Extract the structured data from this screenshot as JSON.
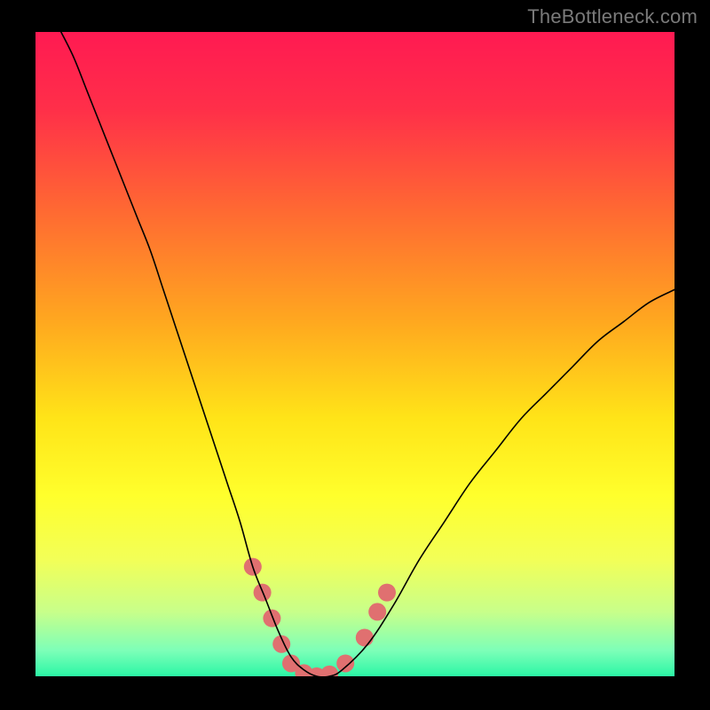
{
  "watermark": {
    "text": "TheBottleneck.com"
  },
  "chart_data": {
    "type": "line",
    "title": "",
    "xlabel": "",
    "ylabel": "",
    "xlim": [
      0,
      100
    ],
    "ylim": [
      0,
      100
    ],
    "grid": false,
    "legend": false,
    "background_gradient": {
      "direction": "vertical",
      "stops": [
        {
          "offset": 0.0,
          "color": "#ff1a52"
        },
        {
          "offset": 0.12,
          "color": "#ff2f49"
        },
        {
          "offset": 0.28,
          "color": "#ff6a32"
        },
        {
          "offset": 0.45,
          "color": "#ffa81f"
        },
        {
          "offset": 0.6,
          "color": "#ffe418"
        },
        {
          "offset": 0.72,
          "color": "#ffff2c"
        },
        {
          "offset": 0.82,
          "color": "#f2ff58"
        },
        {
          "offset": 0.9,
          "color": "#c8ff8a"
        },
        {
          "offset": 0.96,
          "color": "#7dffb8"
        },
        {
          "offset": 1.0,
          "color": "#2bf6a5"
        }
      ]
    },
    "series": [
      {
        "name": "bottleneck-curve",
        "color": "#000000",
        "stroke_width": 1.6,
        "x": [
          4,
          6,
          8,
          10,
          12,
          14,
          16,
          18,
          20,
          22,
          24,
          26,
          28,
          30,
          32,
          34,
          36,
          38,
          40,
          42,
          44,
          46,
          48,
          52,
          56,
          60,
          64,
          68,
          72,
          76,
          80,
          84,
          88,
          92,
          96,
          100
        ],
        "y": [
          100,
          96,
          91,
          86,
          81,
          76,
          71,
          66,
          60,
          54,
          48,
          42,
          36,
          30,
          24,
          17,
          12,
          7,
          3,
          1,
          0,
          0,
          1,
          5,
          11,
          18,
          24,
          30,
          35,
          40,
          44,
          48,
          52,
          55,
          58,
          60
        ]
      }
    ],
    "markers": {
      "name": "highlight-dots",
      "color": "#e07070",
      "radius": 10,
      "points": [
        {
          "x": 34.0,
          "y": 17.0
        },
        {
          "x": 35.5,
          "y": 13.0
        },
        {
          "x": 37.0,
          "y": 9.0
        },
        {
          "x": 38.5,
          "y": 5.0
        },
        {
          "x": 40.0,
          "y": 2.0
        },
        {
          "x": 42.0,
          "y": 0.5
        },
        {
          "x": 44.0,
          "y": 0.0
        },
        {
          "x": 46.0,
          "y": 0.3
        },
        {
          "x": 48.5,
          "y": 2.0
        },
        {
          "x": 51.5,
          "y": 6.0
        },
        {
          "x": 53.5,
          "y": 10.0
        },
        {
          "x": 55.0,
          "y": 13.0
        }
      ]
    }
  }
}
